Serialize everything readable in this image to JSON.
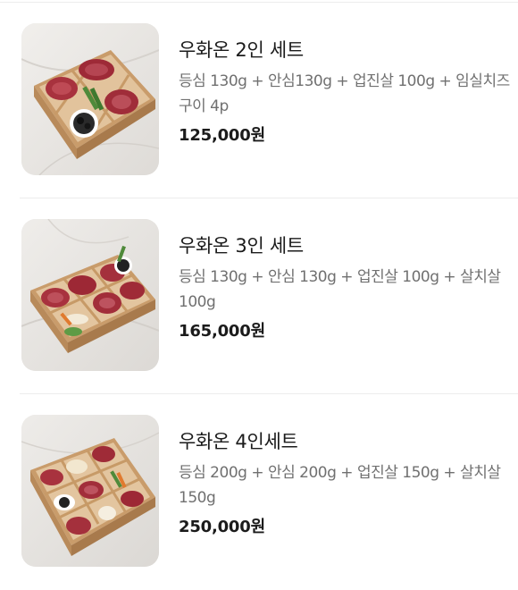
{
  "menu": {
    "items": [
      {
        "name": "우화온 2인 세트",
        "description": "등심 130g + 안심130g + 업진살 100g + 임실치즈구이 4p",
        "price": "125,000원",
        "image_icon": "gift-box-meat-photo"
      },
      {
        "name": "우화온 3인 세트",
        "description": "등심 130g + 안심 130g + 업진살 100g + 살치살 100g",
        "price": "165,000원",
        "image_icon": "gift-box-meat-photo"
      },
      {
        "name": "우화온 4인세트",
        "description": "등심 200g + 안심 200g + 업진살 150g + 살치살 150g",
        "price": "250,000원",
        "image_icon": "gift-box-meat-photo"
      }
    ]
  },
  "colors": {
    "background": "#ffffff",
    "divider": "#ececec",
    "title_text": "#1b1b1b",
    "description_text": "#707070",
    "wood_box": "#d8b487",
    "beef": "#a8323e",
    "marble_backdrop": "#e9e7e4"
  }
}
